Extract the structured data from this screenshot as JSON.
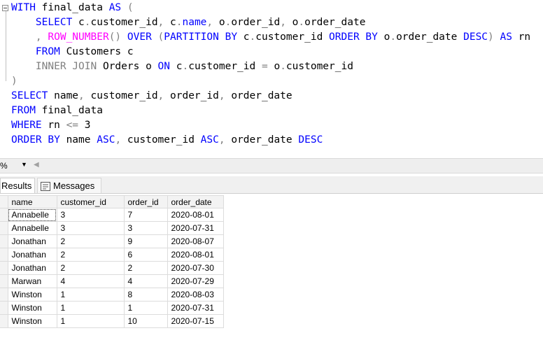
{
  "query": {
    "line1": {
      "kw1": "WITH",
      "t1": " final_data ",
      "kw2": "AS",
      "g1": " ("
    },
    "line2": {
      "indent": "    ",
      "kw1": "SELECT",
      "t1": " c",
      "g1": ".",
      "t2": "customer_id",
      "g2": ", ",
      "t3": "c",
      "g3": ".",
      "kw2": "name",
      "g4": ", ",
      "t4": "o",
      "g5": ".",
      "t5": "order_id",
      "g6": ", ",
      "t6": "o",
      "g7": ".",
      "t7": "order_date"
    },
    "line3": {
      "indent": "    ",
      "g1": ", ",
      "fn1": "ROW_NUMBER",
      "g2": "() ",
      "kw1": "OVER",
      "g3": " (",
      "kw2": "PARTITION BY",
      "t1": " c",
      "g4": ".",
      "t2": "customer_id ",
      "kw3": "ORDER BY",
      "t3": " o",
      "g5": ".",
      "t4": "order_date ",
      "kw4": "DESC",
      "g6": ") ",
      "kw5": "AS",
      "t5": " rn"
    },
    "line4": {
      "indent": "    ",
      "kw1": "FROM",
      "t1": " Customers c"
    },
    "line5": {
      "indent": "    ",
      "g1": "INNER JOIN",
      "t1": " Orders o ",
      "kw1": "ON",
      "t2": " c",
      "g2": ".",
      "t3": "customer_id ",
      "g3": "=",
      "t4": " o",
      "g4": ".",
      "t5": "customer_id"
    },
    "line6": {
      "g1": ")"
    },
    "line7": {
      "kw1": "SELECT",
      "t1": " name",
      "g1": ", ",
      "t2": "customer_id",
      "g2": ", ",
      "t3": "order_id",
      "g3": ", ",
      "t4": "order_date"
    },
    "line8": {
      "kw1": "FROM",
      "t1": " final_data"
    },
    "line9": {
      "kw1": "WHERE",
      "t1": " rn ",
      "g1": "<=",
      "t2": " 3"
    },
    "line10": {
      "kw1": "ORDER BY",
      "t1": " name ",
      "kw2": "ASC",
      "g1": ", ",
      "t2": "customer_id ",
      "kw3": "ASC",
      "g2": ", ",
      "t3": "order_date ",
      "kw4": "DESC"
    }
  },
  "zoom": {
    "value": "%"
  },
  "tabs": {
    "results": "Results",
    "messages": "Messages"
  },
  "grid": {
    "headers": [
      "name",
      "customer_id",
      "order_id",
      "order_date"
    ],
    "rows": [
      [
        "Annabelle",
        "3",
        "7",
        "2020-08-01"
      ],
      [
        "Annabelle",
        "3",
        "3",
        "2020-07-31"
      ],
      [
        "Jonathan",
        "2",
        "9",
        "2020-08-07"
      ],
      [
        "Jonathan",
        "2",
        "6",
        "2020-08-01"
      ],
      [
        "Jonathan",
        "2",
        "2",
        "2020-07-30"
      ],
      [
        "Marwan",
        "4",
        "4",
        "2020-07-29"
      ],
      [
        "Winston",
        "1",
        "8",
        "2020-08-03"
      ],
      [
        "Winston",
        "1",
        "1",
        "2020-07-31"
      ],
      [
        "Winston",
        "1",
        "10",
        "2020-07-15"
      ]
    ]
  },
  "colors": {
    "keyword": "#0000ff",
    "function": "#ff00ff",
    "operator": "#808080"
  }
}
